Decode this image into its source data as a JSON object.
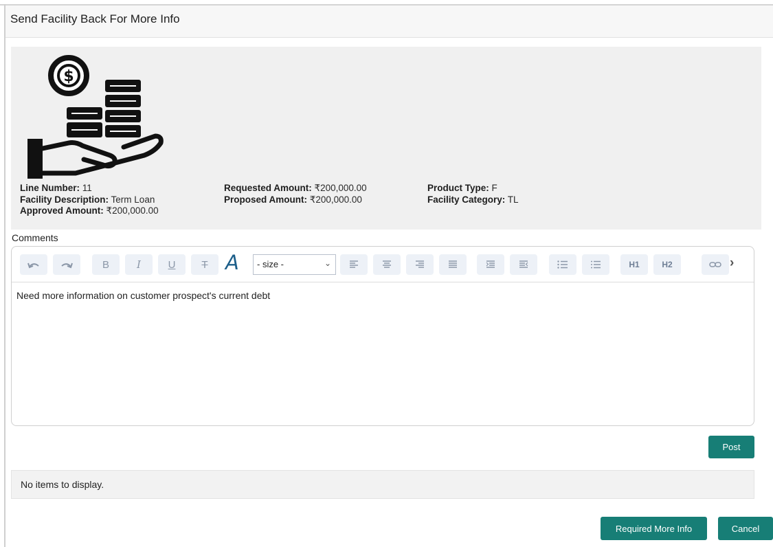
{
  "dialog": {
    "title": "Send Facility Back For More Info"
  },
  "facility": {
    "icon": "money-hand-icon",
    "line_number_label": "Line Number:",
    "line_number": "11",
    "facility_description_label": "Facility Description:",
    "facility_description": "Term Loan",
    "approved_amount_label": "Approved Amount:",
    "approved_amount": "₹200,000.00",
    "requested_amount_label": "Requested Amount:",
    "requested_amount": "₹200,000.00",
    "proposed_amount_label": "Proposed Amount:",
    "proposed_amount": "₹200,000.00",
    "product_type_label": "Product Type:",
    "product_type": "F",
    "facility_category_label": "Facility Category:",
    "facility_category": "TL"
  },
  "comments": {
    "label": "Comments",
    "toolbar": {
      "bold": "B",
      "italic": "I",
      "underline": "U",
      "strikethrough": "T",
      "font_color": "A",
      "size_select": "- size -",
      "h1": "H1",
      "h2": "H2"
    },
    "content": "Need more information on customer prospect's current debt"
  },
  "post_button": "Post",
  "empty_message": "No items to display.",
  "footer": {
    "required_more_info": "Required More Info",
    "cancel": "Cancel"
  },
  "colors": {
    "accent": "#177e76",
    "toolbar_button_bg": "#edf1f7",
    "font_color_icon": "#1d5f8a"
  }
}
